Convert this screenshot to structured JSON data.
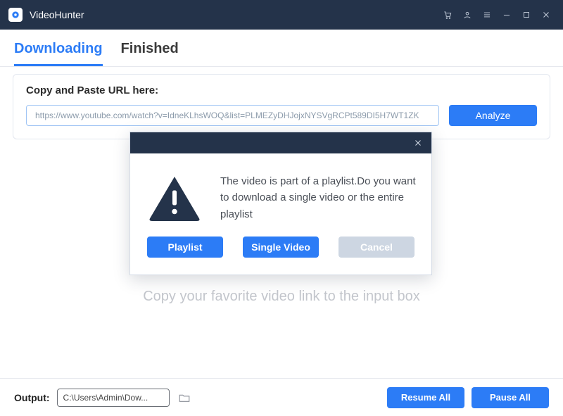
{
  "titlebar": {
    "app_name": "VideoHunter"
  },
  "tabs": {
    "downloading": "Downloading",
    "finished": "Finished",
    "active": "downloading"
  },
  "url_panel": {
    "label": "Copy and Paste URL here:",
    "value": "https://www.youtube.com/watch?v=IdneKLhsWOQ&list=PLMEZyDHJojxNYSVgRCPt589DI5H7WT1ZK",
    "analyze_label": "Analyze"
  },
  "hint": "Copy your favorite video link to the input box",
  "bottombar": {
    "output_label": "Output:",
    "output_path": "C:\\Users\\Admin\\Dow...",
    "resume_label": "Resume All",
    "pause_label": "Pause All"
  },
  "dialog": {
    "message": "The video is part of a playlist.Do you want to download a single video or the entire playlist",
    "playlist_label": "Playlist",
    "single_label": "Single Video",
    "cancel_label": "Cancel"
  }
}
